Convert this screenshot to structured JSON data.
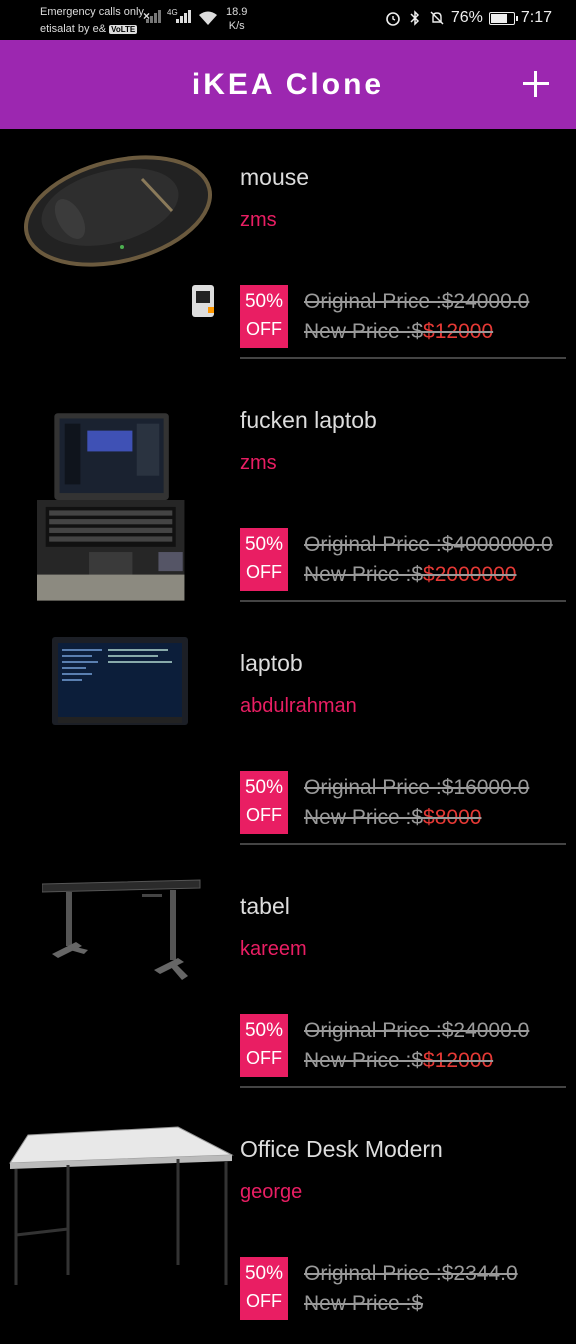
{
  "status_bar": {
    "carrier_line1": "Emergency calls only",
    "carrier_line2": "etisalat by e&",
    "volte": "VoLTE",
    "network": "4G",
    "speed_value": "18.9",
    "speed_unit": "K/s",
    "battery": "76%",
    "battery_level": 0.76,
    "time": "7:17"
  },
  "app_bar": {
    "title": "iKEA Clone",
    "background": "#9c27b0"
  },
  "colors": {
    "accent": "#e91e63",
    "new_price": "#e53935"
  },
  "products": [
    {
      "name": "mouse",
      "seller": "zms",
      "discount": "50%",
      "off": "OFF",
      "original_price": "Original Price :$24000.0",
      "new_price_label": "New Price :$",
      "new_price": "$12000",
      "image": "computer-mouse"
    },
    {
      "name": "fucken laptob",
      "seller": "zms",
      "discount": "50%",
      "off": "OFF",
      "original_price": "Original Price :$4000000.0",
      "new_price_label": "New Price :$",
      "new_price": "$2000000",
      "image": "laptop-open"
    },
    {
      "name": "laptob",
      "seller": "abdulrahman",
      "discount": "50%",
      "off": "OFF",
      "original_price": "Original Price :$16000.0",
      "new_price_label": "New Price :$",
      "new_price": "$8000",
      "image": "laptop-screen"
    },
    {
      "name": "tabel",
      "seller": "kareem",
      "discount": "50%",
      "off": "OFF",
      "original_price": "Original Price :$24000.0",
      "new_price_label": "New Price :$",
      "new_price": "$12000",
      "image": "gaming-desk"
    },
    {
      "name": "Office Desk Modern",
      "seller": "george",
      "discount": "50%",
      "off": "OFF",
      "original_price": "Original Price :$2344.0",
      "new_price_label": "New Price :$",
      "new_price": "",
      "image": "white-desk"
    }
  ]
}
